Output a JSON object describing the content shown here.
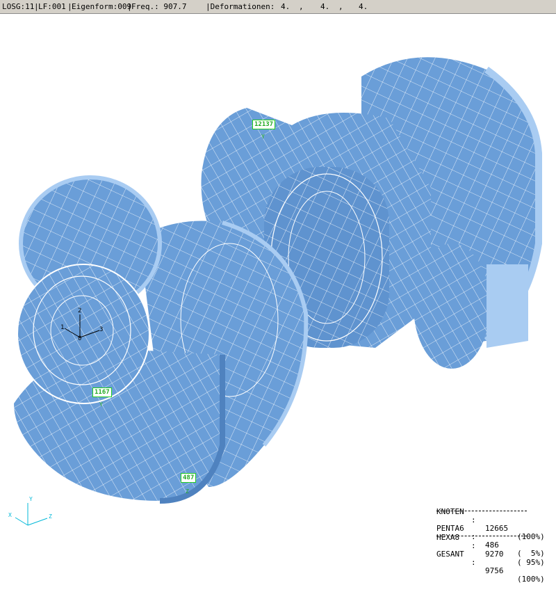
{
  "header": {
    "losg": "LOSG:11",
    "lf": "LF:001",
    "eigenform": "Eigenform:009",
    "freq": "Freq.: 907.7",
    "deformation_label": "|Deformationen:",
    "deformation_values": [
      "4.",
      ",",
      "4.",
      ",",
      "4."
    ]
  },
  "nodes": [
    {
      "id": "12137",
      "axis": "Y"
    },
    {
      "id": "1167",
      "axis": "Y"
    },
    {
      "id": "487",
      "axis": "Z"
    }
  ],
  "local_axes": {
    "one": "1",
    "two": "2",
    "three": "3",
    "origin": "0"
  },
  "global_axes": {
    "x": "X",
    "y": "Y",
    "z": "Z"
  },
  "stats": {
    "knoten": {
      "label": "KNOTEN",
      "colon": ":",
      "value": "12665",
      "pct": "(100%)"
    },
    "penta6": {
      "label": "PENTA6",
      "colon": ":",
      "value": "486",
      "pct": "(  5%)"
    },
    "hexa8": {
      "label": "HEXA8",
      "colon": ":",
      "value": "9270",
      "pct": "( 95%)"
    },
    "gesamt": {
      "label": "GESANT",
      "colon": ":",
      "value": "9756",
      "pct": "(100%)"
    }
  },
  "colors": {
    "mesh_fill": "#6a9ed8",
    "mesh_light": "#a9ccf2",
    "mesh_dark": "#4f82bf",
    "node_tag": "#22cc22",
    "header_bg": "#d4d0c8"
  }
}
